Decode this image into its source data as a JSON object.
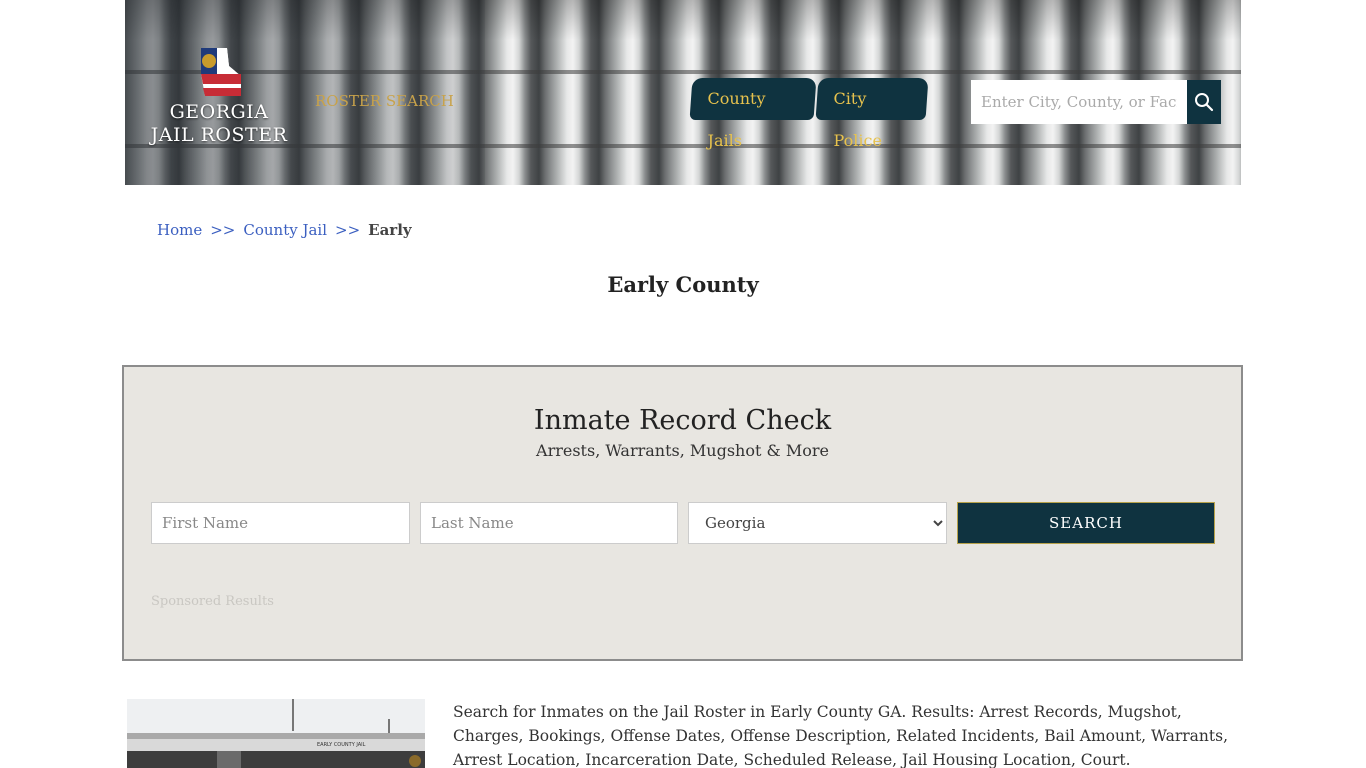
{
  "header": {
    "logo_text_line1": "GEORGIA",
    "logo_text_line2": "JAIL ROSTER",
    "roster_search": "ROSTER SEARCH",
    "nav": [
      {
        "label": "County Jails"
      },
      {
        "label": "City Police"
      }
    ],
    "search": {
      "placeholder": "Enter City, County, or Facility"
    }
  },
  "breadcrumb": {
    "home": "Home",
    "sep": ">>",
    "county_jail": "County Jail",
    "current": "Early"
  },
  "page_title": "Early County",
  "record_check": {
    "title": "Inmate Record Check",
    "subtitle": "Arrests, Warrants, Mugshot & More",
    "first_name_placeholder": "First Name",
    "last_name_placeholder": "Last Name",
    "state_selected": "Georgia",
    "search_button": "SEARCH",
    "sponsored": "Sponsored Results"
  },
  "description": "Search for Inmates on the Jail Roster in Early County GA. Results: Arrest Records, Mugshot, Charges, Bookings, Offense Dates, Offense Description, Related Incidents, Bail Amount, Warrants, Arrest Location, Incarceration Date, Scheduled Release, Jail Housing Location, Court.",
  "photo_sign": "EARLY COUNTY JAIL",
  "colors": {
    "nav_bg": "#0f3340",
    "nav_text": "#e7c24d",
    "link": "#3b5fc0",
    "panel_bg": "#e8e6e1"
  }
}
